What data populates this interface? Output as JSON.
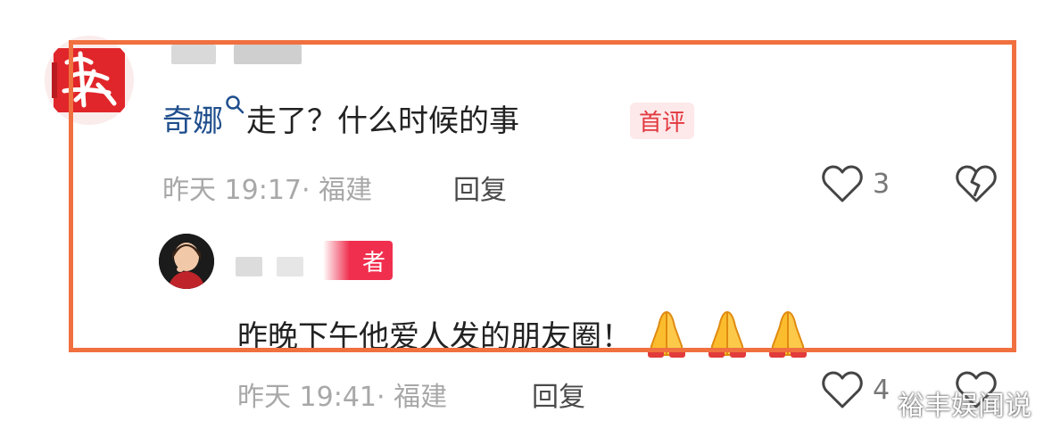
{
  "comment": {
    "mention_name": "奇娜",
    "text": "走了？什么时候的事",
    "badge": "首评",
    "time_location": "昨天 19:17· 福建",
    "reply_label": "回复",
    "like_count": "3"
  },
  "reply": {
    "badge": "者",
    "text": "昨晚下午他爱人发的朋友圈！",
    "time_location": "昨天 19:41· 福建",
    "reply_label": "回复",
    "like_count": "4"
  },
  "watermark": "裕丰娱闻说",
  "colors": {
    "highlight": "#f07040",
    "mention": "#1f4e8d",
    "first_badge_bg": "#fde8ea",
    "first_badge_text": "#e2393f",
    "author_badge": "#f02f4e"
  },
  "icons": [
    "search-icon",
    "heart-icon",
    "broken-heart-icon",
    "folded-hands-emoji"
  ]
}
